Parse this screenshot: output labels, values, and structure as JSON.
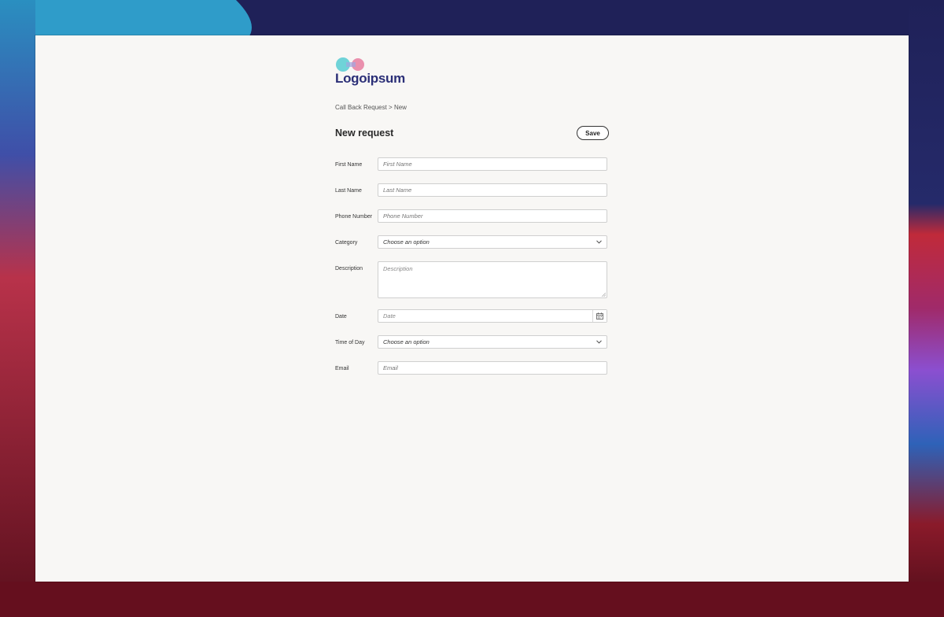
{
  "colors": {
    "window_bg": "#f8f7f5",
    "brand_text": "#2b2f77",
    "logo_teal": "#6fd3d8",
    "logo_pink": "#e77ea0",
    "border": "#cfcfcf"
  },
  "logo": {
    "text": "Logoipsum",
    "icon": "logo-mark"
  },
  "breadcrumb": {
    "parent": "Call Back Request",
    "separator": ">",
    "current": "New"
  },
  "header": {
    "title": "New request",
    "save_label": "Save"
  },
  "form": {
    "fields": [
      {
        "label": "First Name",
        "type": "text",
        "placeholder": "First Name",
        "value": ""
      },
      {
        "label": "Last Name",
        "type": "text",
        "placeholder": "Last Name",
        "value": ""
      },
      {
        "label": "Phone Number",
        "type": "text",
        "placeholder": "Phone Number",
        "value": ""
      },
      {
        "label": "Category",
        "type": "select",
        "selected": "Choose an option"
      },
      {
        "label": "Description",
        "type": "textarea",
        "placeholder": "Description",
        "value": ""
      },
      {
        "label": "Date",
        "type": "date",
        "placeholder": "Date",
        "value": "",
        "icon": "calendar-icon"
      },
      {
        "label": "Time of Day",
        "type": "select",
        "selected": "Choose an option"
      },
      {
        "label": "Email",
        "type": "text",
        "placeholder": "Email",
        "value": ""
      }
    ]
  }
}
